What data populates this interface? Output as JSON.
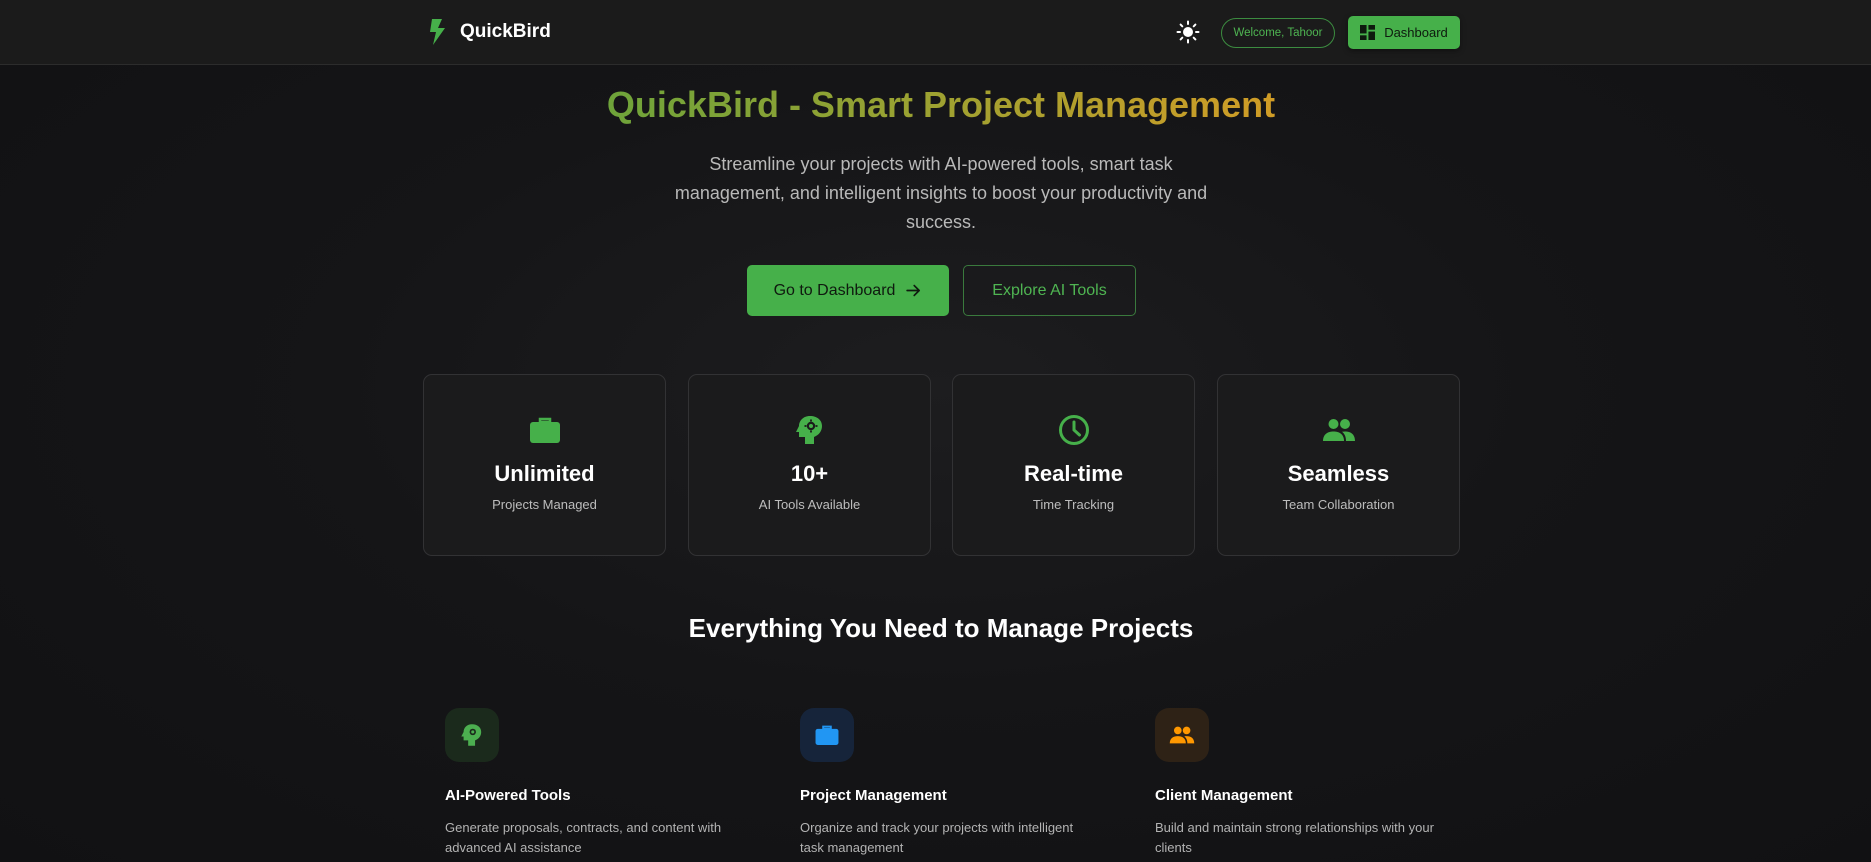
{
  "navbar": {
    "brand": "QuickBird",
    "brand_icon": "lightning-bolt-icon",
    "theme_icon": "sun-icon",
    "welcome": "Welcome, Tahoor",
    "dashboard_label": "Dashboard",
    "dashboard_icon": "dashboard-grid-icon"
  },
  "hero": {
    "title": "QuickBird - Smart Project Management",
    "subtitle": "Streamline your projects with AI-powered tools, smart task management, and intelligent insights to boost your productivity and success.",
    "primary_cta": "Go to Dashboard",
    "primary_cta_icon": "arrow-right-icon",
    "secondary_cta": "Explore AI Tools"
  },
  "stats": [
    {
      "icon": "briefcase-icon",
      "value": "Unlimited",
      "label": "Projects Managed"
    },
    {
      "icon": "brain-gear-icon",
      "value": "10+",
      "label": "AI Tools Available"
    },
    {
      "icon": "clock-icon",
      "value": "Real-time",
      "label": "Time Tracking"
    },
    {
      "icon": "people-icon",
      "value": "Seamless",
      "label": "Team Collaboration"
    }
  ],
  "features_section": {
    "title": "Everything You Need to Manage Projects",
    "items": [
      {
        "icon": "brain-gear-icon",
        "title": "AI-Powered Tools",
        "description": "Generate proposals, contracts, and content with advanced AI assistance",
        "accent": "#4caf50"
      },
      {
        "icon": "briefcase-icon",
        "title": "Project Management",
        "description": "Organize and track your projects with intelligent task management",
        "accent": "#2196f3"
      },
      {
        "icon": "people-icon",
        "title": "Client Management",
        "description": "Build and maintain strong relationships with your clients",
        "accent": "#ff9800"
      }
    ]
  },
  "colors": {
    "accent_green": "#46b04a",
    "background": "#131315",
    "card": "#1b1b1c",
    "title_gradient_start": "#6ea33a",
    "title_gradient_end": "#d09c26"
  }
}
